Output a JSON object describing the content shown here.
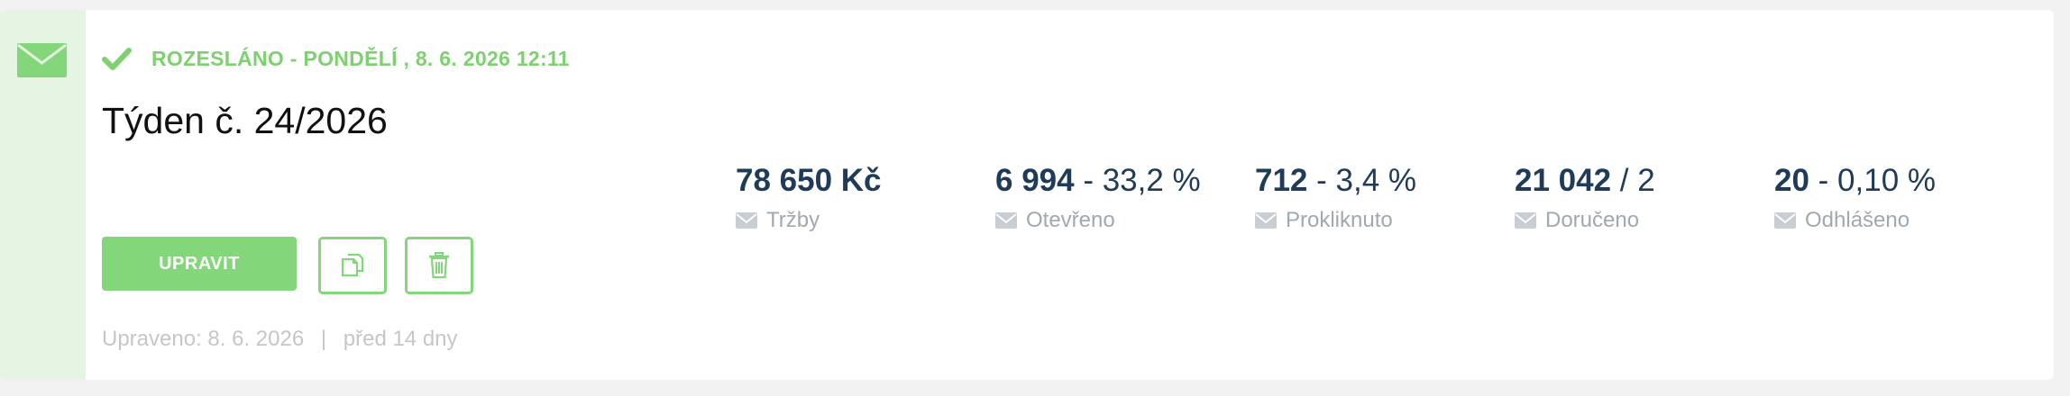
{
  "campaign": {
    "status_text": "ROZESLÁNO - PONDĚLÍ , 8. 6. 2026 12:11",
    "title": "Týden č. 24/2026",
    "edit_button": "UPRAVIT",
    "meta": {
      "modified_label": "Upraveno:",
      "modified_date": "8. 6. 2026",
      "separator": "|",
      "relative": "před 14 dny"
    }
  },
  "stats": [
    {
      "main": "78 650 Kč",
      "sub": "",
      "label": "Tržby"
    },
    {
      "main": "6 994",
      "sub": " - 33,2 %",
      "label": "Otevřeno"
    },
    {
      "main": "712",
      "sub": " - 3,4 %",
      "label": "Prokliknuto"
    },
    {
      "main": "21 042",
      "sub": " / 2",
      "label": "Doručeno"
    },
    {
      "main": "20",
      "sub": " - 0,10 %",
      "label": "Odhlášeno"
    }
  ],
  "icons": {
    "strip": "envelope-icon",
    "status": "checkmark-icon",
    "copy": "copy-icon",
    "delete": "trash-icon",
    "stat": "envelope-icon"
  },
  "colors": {
    "accent_green": "#84d67a",
    "status_green": "#7ed071",
    "strip_bg": "#e6f5e3",
    "stat_value": "#1f3b57",
    "stat_label": "#a0a8b0",
    "meta_text": "#c6c6c6"
  }
}
